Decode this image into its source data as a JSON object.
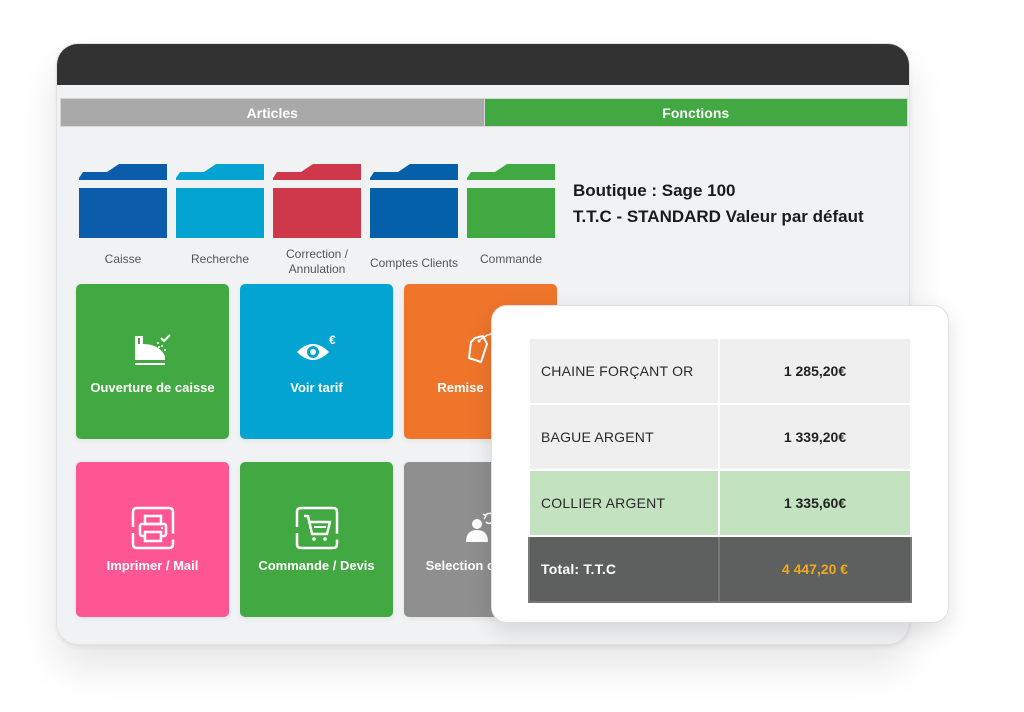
{
  "tabs": [
    {
      "label": "Articles",
      "active": false
    },
    {
      "label": "Fonctions",
      "active": true
    }
  ],
  "folders": [
    {
      "label": "Caisse",
      "color": "#0b5cab",
      "tab_color": "#0b5cab"
    },
    {
      "label": "Recherche",
      "color": "#04a4d2",
      "tab_color": "#04a4d2"
    },
    {
      "label": "Correction / Annulation",
      "color": "#cf374b",
      "tab_color": "#cf374b"
    },
    {
      "label": "Comptes Clients",
      "color": "#0460a8",
      "tab_color": "#0460a8"
    },
    {
      "label": "Commande",
      "color": "#41a941",
      "tab_color": "#41a941"
    }
  ],
  "info": {
    "shop": "Boutique : Sage 100",
    "pricing": "T.T.C - STANDARD Valeur par défaut"
  },
  "tiles": [
    {
      "label": "Ouverture de caisse",
      "icon": "cash-register-icon",
      "color": "#42a942"
    },
    {
      "label": "Voir tarif",
      "icon": "eye-euro-icon",
      "color": "#03a4d1"
    },
    {
      "label": "Remise",
      "icon": "price-tag-icon",
      "color": "#ef752b"
    },
    {
      "label": "Imprimer / Mail",
      "icon": "printer-icon",
      "color": "#fe5693"
    },
    {
      "label": "Commande / Devis",
      "icon": "shopping-cart-icon",
      "color": "#42a942"
    },
    {
      "label": "Selection caissier",
      "icon": "user-switch-icon",
      "color": "#8f8f8f"
    }
  ],
  "ticket": {
    "lines": [
      {
        "name": "CHAINE FORÇANT OR",
        "price": "1 285,20€",
        "highlighted": false
      },
      {
        "name": "BAGUE ARGENT",
        "price": "1 339,20€",
        "highlighted": false
      },
      {
        "name": "COLLIER ARGENT",
        "price": "1 335,60€",
        "highlighted": true
      }
    ],
    "total_label": "Total: T.T.C",
    "total_value": "4 447,20 €",
    "total_color": "#f0a81e"
  }
}
